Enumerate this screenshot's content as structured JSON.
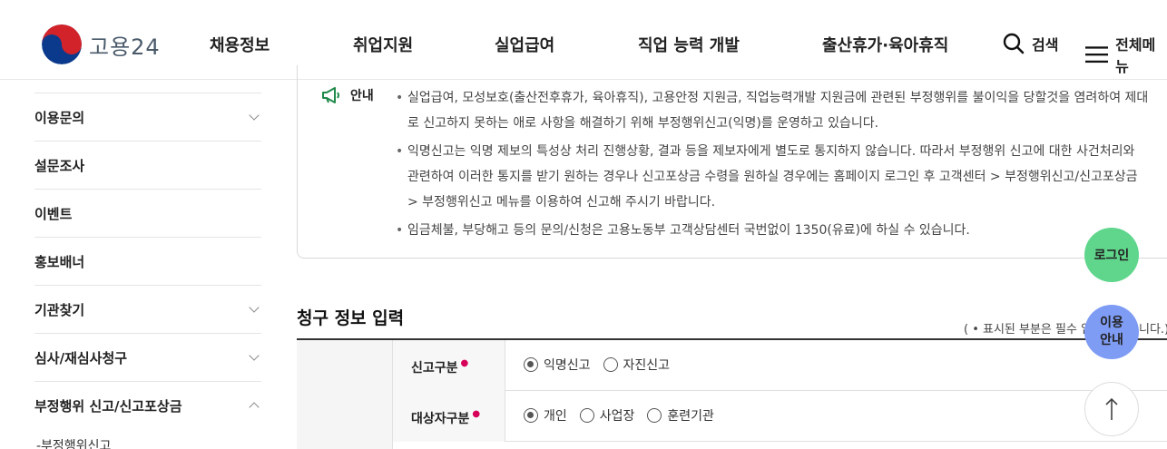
{
  "header": {
    "logo_text": "고용24",
    "nav": [
      "채용정보",
      "취업지원",
      "실업급여",
      "직업 능력 개발",
      "출산휴가·육아휴직"
    ],
    "search_label": "검색",
    "menu_label": "전체메뉴"
  },
  "sidebar": {
    "items": [
      {
        "label": "이용문의"
      },
      {
        "label": "설문조사"
      },
      {
        "label": "이벤트"
      },
      {
        "label": "홍보배너"
      },
      {
        "label": "기관찾기"
      },
      {
        "label": "심사/재심사청구"
      },
      {
        "label": "부정행위 신고/신고포상금"
      }
    ],
    "sub_item": "-부정행위신고"
  },
  "notice": {
    "title": "안내",
    "items": [
      "실업급여, 모성보호(출산전후휴가, 육아휴직), 고용안정 지원금, 직업능력개발 지원금에 관련된 부정행위를 불이익을 당할것을 염려하여 제대로 신고하지 못하는 애로 사항을 해결하기 위해 부정행위신고(익명)를 운영하고 있습니다.",
      "익명신고는 익명 제보의 특성상 처리 진행상황, 결과 등을 제보자에게 별도로 통지하지 않습니다. 따라서 부정행위 신고에 대한 사건처리와 관련하여 이러한 통지를 받기 원하는 경우나 신고포상금 수령을 원하실 경우에는 홈페이지 로그인 후 고객센터 > 부정행위신고/신고포상금 > 부정행위신고 메뉴를 이용하여 신고해 주시기 바랍니다.",
      "임금체불, 부당해고 등의 문의/신청은 고용노동부 고객상담센터 국번없이 1350(유료)에 하실 수 있습니다."
    ]
  },
  "form": {
    "section_title": "청구 정보 입력",
    "required_note": "( • 표시된 부분은 필수 입력 항목입니다.)",
    "rows": [
      {
        "label": "신고구분",
        "options": [
          "익명신고",
          "자진신고"
        ],
        "selected": "익명신고"
      },
      {
        "label": "대상자구분",
        "options": [
          "개인",
          "사업장",
          "훈련기관"
        ],
        "selected": "개인"
      }
    ]
  },
  "floating": {
    "login": "로그인",
    "guide_line1": "이용",
    "guide_line2": "안내"
  },
  "colors": {
    "login_bg": "#5fd68c",
    "guide_bg": "#7f9cf5",
    "required": "#d6005b"
  }
}
